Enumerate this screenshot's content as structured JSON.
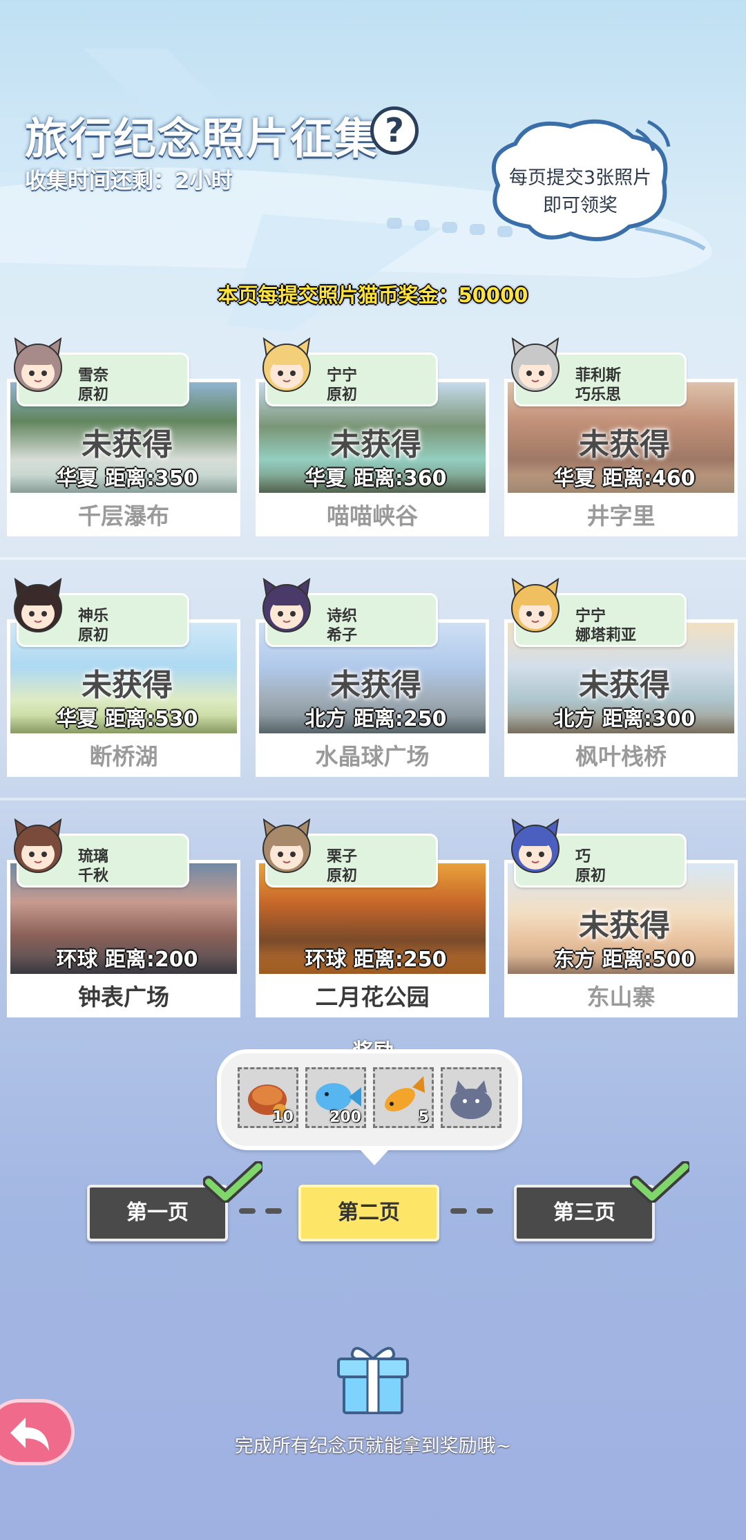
{
  "header": {
    "title": "旅行纪念照片征集",
    "timer": "收集时间还剩：2小时",
    "bubble_line1": "每页提交3张照片",
    "bubble_line2": "即可领奖",
    "bonus": "本页每提交照片猫币奖金：50000"
  },
  "cards": [
    {
      "name1": "雪奈",
      "name2": "原初",
      "lock": "未获得",
      "distance": "华夏 距离:350",
      "caption": "千层瀑布",
      "obtained": false
    },
    {
      "name1": "宁宁",
      "name2": "原初",
      "lock": "未获得",
      "distance": "华夏 距离:360",
      "caption": "喵喵峡谷",
      "obtained": false
    },
    {
      "name1": "菲利斯",
      "name2": "巧乐思",
      "lock": "未获得",
      "distance": "华夏 距离:460",
      "caption": "井字里",
      "obtained": false
    },
    {
      "name1": "神乐",
      "name2": "原初",
      "lock": "未获得",
      "distance": "华夏 距离:530",
      "caption": "断桥湖",
      "obtained": false
    },
    {
      "name1": "诗织",
      "name2": "希子",
      "lock": "未获得",
      "distance": "北方 距离:250",
      "caption": "水晶球广场",
      "obtained": false
    },
    {
      "name1": "宁宁",
      "name2": "娜塔莉亚",
      "lock": "未获得",
      "distance": "北方 距离:300",
      "caption": "枫叶栈桥",
      "obtained": false
    },
    {
      "name1": "琉璃",
      "name2": "千秋",
      "lock": "",
      "distance": "环球 距离:200",
      "caption": "钟表广场",
      "obtained": true
    },
    {
      "name1": "栗子",
      "name2": "原初",
      "lock": "",
      "distance": "环球 距离:250",
      "caption": "二月花公园",
      "obtained": true
    },
    {
      "name1": "巧",
      "name2": "原初",
      "lock": "未获得",
      "distance": "东方 距离:500",
      "caption": "东山寨",
      "obtained": false
    }
  ],
  "reward": {
    "title": "奖励",
    "items": [
      {
        "icon": "bread-icon",
        "count": "10"
      },
      {
        "icon": "blue-fish-icon",
        "count": "200"
      },
      {
        "icon": "golden-fish-icon",
        "count": "5"
      },
      {
        "icon": "cat-plush-icon",
        "count": ""
      }
    ]
  },
  "pages": [
    {
      "label": "第一页",
      "completed": true,
      "active": false
    },
    {
      "label": "第二页",
      "completed": false,
      "active": true
    },
    {
      "label": "第三页",
      "completed": true,
      "active": false
    }
  ],
  "footer": {
    "hint": "完成所有纪念页就能拿到奖励哦~"
  },
  "colors": {
    "tag_bg": "#dff3df",
    "active_page": "#fde567",
    "inactive_page": "#4a4a4a",
    "bonus_text": "#ffe33b",
    "back_button": "#f06a8b",
    "check_green": "#7fd66a"
  }
}
